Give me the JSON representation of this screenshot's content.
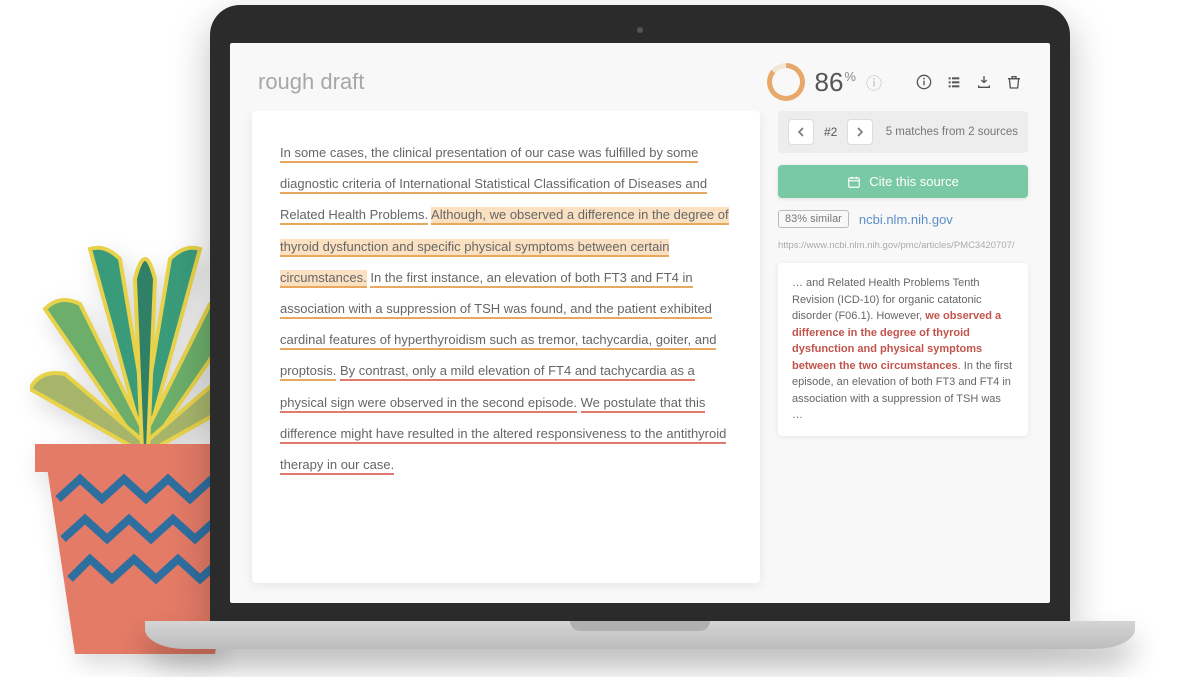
{
  "title": "rough draft",
  "score": {
    "value": "86",
    "unit": "%"
  },
  "toolbar_icons": [
    "info",
    "list",
    "download",
    "trash"
  ],
  "essay": {
    "segments": [
      {
        "text": "In some cases, the clinical presentation of our case was fulfilled by some diagnostic criteria of International Statistical Classification of Diseases and Related Health Problems.",
        "cls": "u-orange"
      },
      {
        "text": " "
      },
      {
        "text": "Although, we observed a difference in the degree of thyroid dysfunction and specific physical symptoms between certain circumstances.",
        "cls": "hl-orange"
      },
      {
        "text": " "
      },
      {
        "text": "In the first instance, an elevation of both FT3 and FT4 in association with a suppression of TSH was found, and the patient exhibited cardinal features of hyperthyroidism such as tremor, tachycardia, goiter, and proptosis.",
        "cls": "u-orange"
      },
      {
        "text": " "
      },
      {
        "text": "By contrast, only a mild elevation of FT4 and tachycardia as a physical sign were observed in the second episode.",
        "cls": "u-red"
      },
      {
        "text": " "
      },
      {
        "text": "We postulate that this difference might have resulted in the altered responsiveness to the antithyroid therapy in our case.",
        "cls": "u-red"
      }
    ]
  },
  "match_nav": {
    "index": "#2",
    "summary": "5 matches from 2 sources"
  },
  "cite_button": "Cite this source",
  "source": {
    "similarity": "83% similar",
    "domain": "ncbi.nlm.nih.gov",
    "url": "https://www.ncbi.nlm.nih.gov/pmc/articles/PMC3420707/"
  },
  "excerpt": {
    "pre": "… and Related Health Problems Tenth Revision (ICD-10) for organic catatonic disorder (F06.1). However, ",
    "match": "we observed a difference in the degree of thyroid dysfunction and physical symptoms between the two circumstances",
    "post": ". In the first episode, an elevation of both FT3 and FT4 in association with a suppression of TSH was …"
  }
}
